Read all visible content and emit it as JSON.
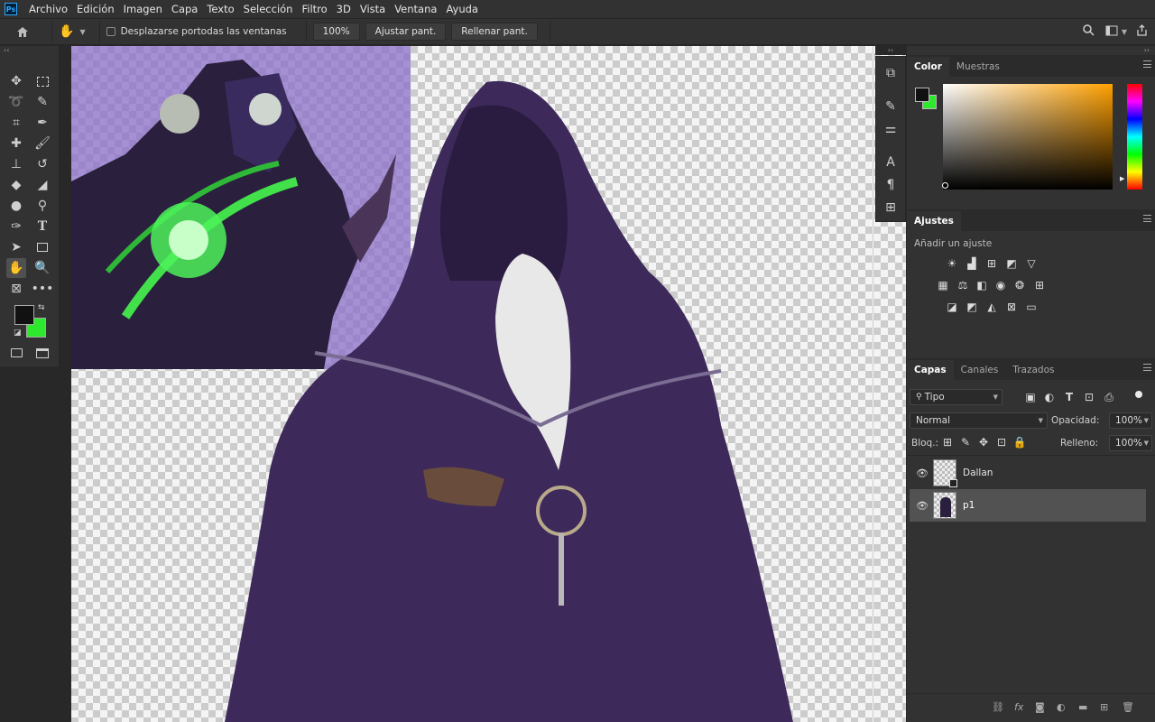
{
  "menu": [
    "Archivo",
    "Edición",
    "Imagen",
    "Capa",
    "Texto",
    "Selección",
    "Filtro",
    "3D",
    "Vista",
    "Ventana",
    "Ayuda"
  ],
  "app_logo": "Ps",
  "options": {
    "scroll_all_label": "Desplazarse portodas las ventanas",
    "zoom_value": "100%",
    "fit_screen": "Ajustar pant.",
    "fill_screen": "Rellenar pant."
  },
  "panels": {
    "color": {
      "tabs": [
        "Color",
        "Muestras"
      ],
      "foreground": "#111111",
      "background": "#2ee82e",
      "hue_color": "#ffa000"
    },
    "adjust": {
      "tab": "Ajustes",
      "hint": "Añadir un ajuste"
    },
    "layers": {
      "tabs": [
        "Capas",
        "Canales",
        "Trazados"
      ],
      "filter_kind": "Tipo",
      "blend_mode": "Normal",
      "opacity_label": "Opacidad:",
      "opacity_value": "100%",
      "lock_label": "Bloq.:",
      "fill_label": "Relleno:",
      "fill_value": "100%",
      "items": [
        {
          "name": "Dallan",
          "visible": true,
          "selected": false
        },
        {
          "name": "p1",
          "visible": true,
          "selected": true
        }
      ]
    }
  },
  "colors": {
    "chrome": "#323232",
    "panel_dark": "#2b2b2b",
    "selection": "#525252"
  }
}
